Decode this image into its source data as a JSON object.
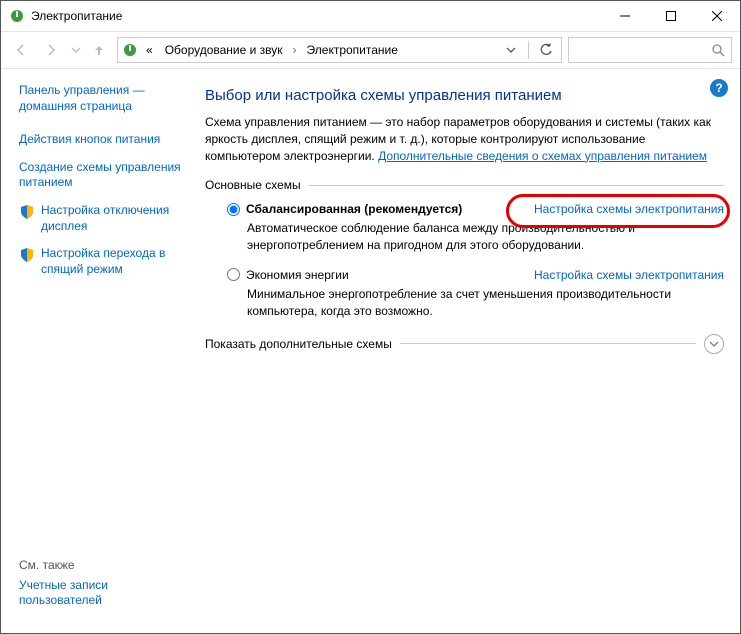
{
  "window": {
    "title": "Электропитание"
  },
  "breadcrumb": {
    "prefix": "«",
    "item1": "Оборудование и звук",
    "item2": "Электропитание"
  },
  "sidebar": {
    "home": "Панель управления — домашняя страница",
    "items": [
      "Действия кнопок питания",
      "Создание схемы управления питанием",
      "Настройка отключения дисплея",
      "Настройка перехода в спящий режим"
    ],
    "see_also_label": "См. также",
    "see_also_link": "Учетные записи пользователей"
  },
  "main": {
    "heading": "Выбор или настройка схемы управления питанием",
    "description": "Схема управления питанием — это набор параметров оборудования и системы (таких как яркость дисплея, спящий режим и т. д.), которые контролируют использование компьютером электроэнергии. ",
    "description_link": "Дополнительные сведения о схемах управления питанием",
    "plans_title": "Основные схемы",
    "plan_settings_link": "Настройка схемы электропитания",
    "plans": [
      {
        "label": "Сбалансированная (рекомендуется)",
        "desc": "Автоматическое соблюдение баланса между производительностью и энергопотреблением на пригодном для этого оборудовании.",
        "selected": true
      },
      {
        "label": "Экономия энергии",
        "desc": "Минимальное энергопотребление за счет уменьшения производительности компьютера, когда это возможно.",
        "selected": false
      }
    ],
    "expand_label": "Показать дополнительные схемы"
  }
}
